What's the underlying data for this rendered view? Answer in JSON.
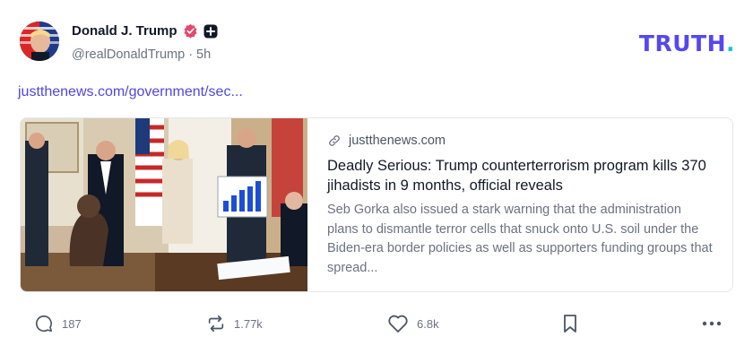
{
  "post": {
    "author_name": "Donald J. Trump",
    "handle": "@realDonaldTrump",
    "separator": "·",
    "time_ago": "5h",
    "link_text": "justthenews.com/government/sec..."
  },
  "brand": {
    "wordmark": "TRUTH",
    "dot": ".",
    "color": "#5448ee",
    "dot_color": "#19c2d7"
  },
  "card": {
    "domain": "justthenews.com",
    "title": "Deadly Serious: Trump counterterrorism program kills 370 jihadists in 9 months, official reveals",
    "description": "Seb Gorka also issued a stark warning that the administration plans to dismantle terror cells that snuck onto U.S. soil under the Biden-era border policies as well as supporters funding groups that spread..."
  },
  "actions": {
    "reply_count": "187",
    "retruth_count": "1.77k",
    "like_count": "6.8k"
  },
  "icons": [
    "verified-badge-icon",
    "plus-badge-icon",
    "link-icon",
    "reply-icon",
    "retruth-icon",
    "heart-icon",
    "bookmark-icon",
    "more-icon"
  ],
  "colors": {
    "link": "#4f46e5",
    "verified": "#e5476a",
    "muted": "#6b7280"
  }
}
